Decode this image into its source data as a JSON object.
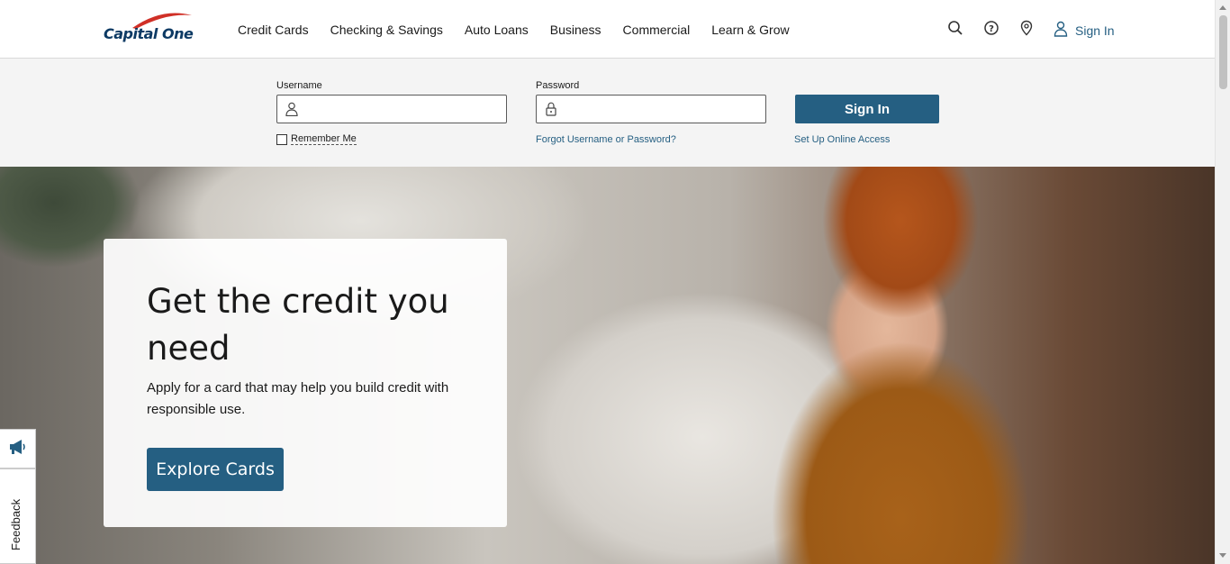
{
  "header": {
    "logo_text": "Capital One",
    "nav": [
      "Credit Cards",
      "Checking & Savings",
      "Auto Loans",
      "Business",
      "Commercial",
      "Learn & Grow"
    ],
    "utility_icons": [
      "search-icon",
      "help-icon",
      "location-icon",
      "user-icon"
    ],
    "sign_in_label": "Sign In"
  },
  "login": {
    "username_label": "Username",
    "username_value": "",
    "password_label": "Password",
    "password_value": "",
    "sign_in_button": "Sign In",
    "remember_me": "Remember Me",
    "remember_checked": false,
    "forgot_link": "Forgot Username or Password?",
    "setup_link": "Set Up Online Access"
  },
  "hero": {
    "title": "Get the credit you need",
    "subtitle": "Apply for a card that may help you build credit with responsible use.",
    "cta": "Explore Cards"
  },
  "feedback": {
    "icon": "megaphone-icon",
    "label": "Feedback"
  },
  "colors": {
    "brand_blue": "#255f82",
    "logo_navy": "#0d3a64",
    "logo_red": "#d03027"
  }
}
